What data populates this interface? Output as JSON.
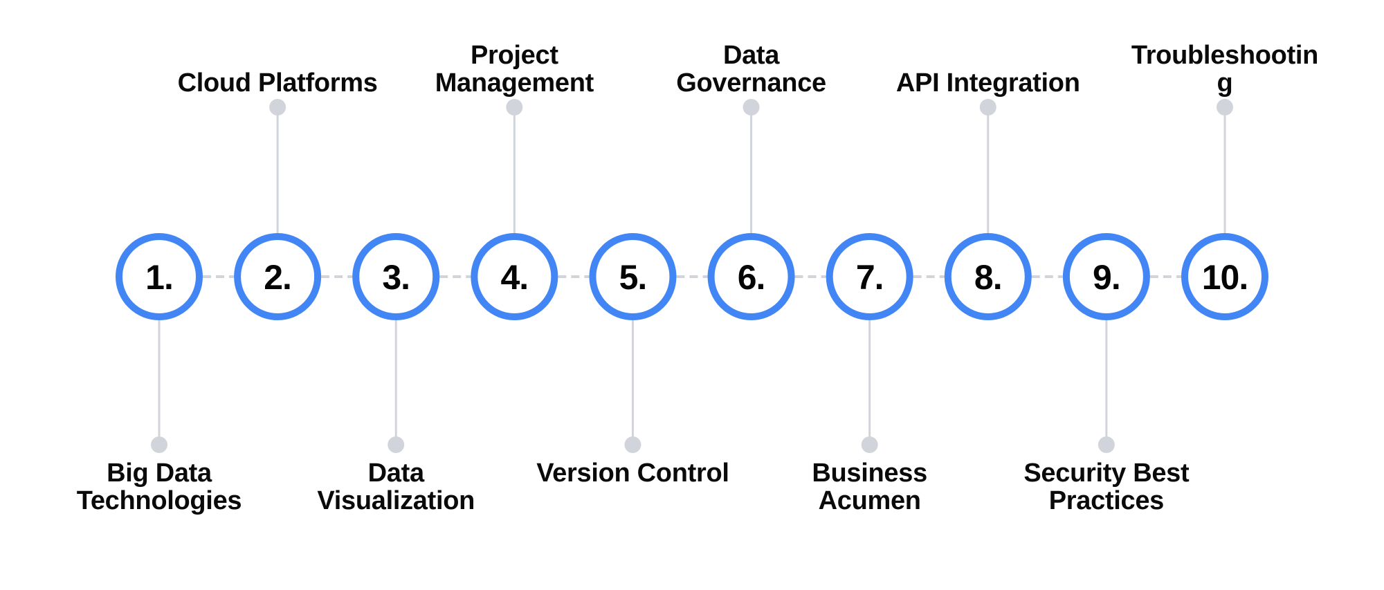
{
  "diagram": {
    "type": "numbered-timeline",
    "accent_color": "#4285F4",
    "connector_color": "#D1D5DB",
    "text_color": "#0A0A0A",
    "steps": [
      {
        "number": "1.",
        "label_lines": [
          "Big Data",
          "Technologies"
        ],
        "position": "below"
      },
      {
        "number": "2.",
        "label_lines": [
          "Cloud Platforms"
        ],
        "position": "above"
      },
      {
        "number": "3.",
        "label_lines": [
          "Data",
          "Visualization"
        ],
        "position": "below"
      },
      {
        "number": "4.",
        "label_lines": [
          "Project",
          "Management"
        ],
        "position": "above"
      },
      {
        "number": "5.",
        "label_lines": [
          "Version Control"
        ],
        "position": "below"
      },
      {
        "number": "6.",
        "label_lines": [
          "Data",
          "Governance"
        ],
        "position": "above"
      },
      {
        "number": "7.",
        "label_lines": [
          "Business",
          "Acumen"
        ],
        "position": "below"
      },
      {
        "number": "8.",
        "label_lines": [
          "API Integration"
        ],
        "position": "above"
      },
      {
        "number": "9.",
        "label_lines": [
          "Security Best",
          "Practices"
        ],
        "position": "below"
      },
      {
        "number": "10.",
        "label_lines": [
          "Troubleshootin",
          "g"
        ],
        "position": "above"
      }
    ]
  }
}
